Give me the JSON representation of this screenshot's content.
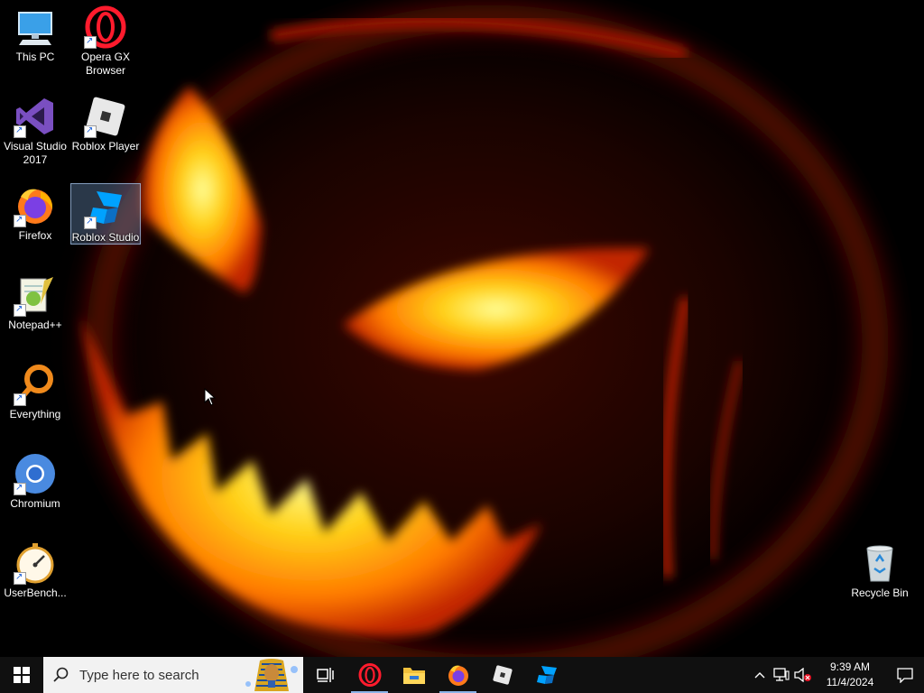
{
  "desktop": {
    "icons": [
      {
        "label": "This PC"
      },
      {
        "label": "Opera GX Browser"
      },
      {
        "label": "Visual Studio 2017"
      },
      {
        "label": "Roblox Player"
      },
      {
        "label": "Firefox"
      },
      {
        "label": "Roblox Studio"
      },
      {
        "label": "Notepad++"
      },
      {
        "label": "Everything"
      },
      {
        "label": "Chromium"
      },
      {
        "label": "UserBench..."
      },
      {
        "label": "Recycle Bin"
      }
    ]
  },
  "taskbar": {
    "search_placeholder": "Type here to search",
    "pinned": [
      "task-view",
      "opera-gx",
      "file-explorer",
      "firefox",
      "roblox-player",
      "roblox-studio"
    ],
    "clock": {
      "time": "9:39 AM",
      "date": "11/4/2024"
    }
  },
  "colors": {
    "taskbar": "#101010",
    "accent": "#8ab4e8",
    "opera": "#ff1b2d",
    "roblox_studio": "#00a2ff"
  }
}
